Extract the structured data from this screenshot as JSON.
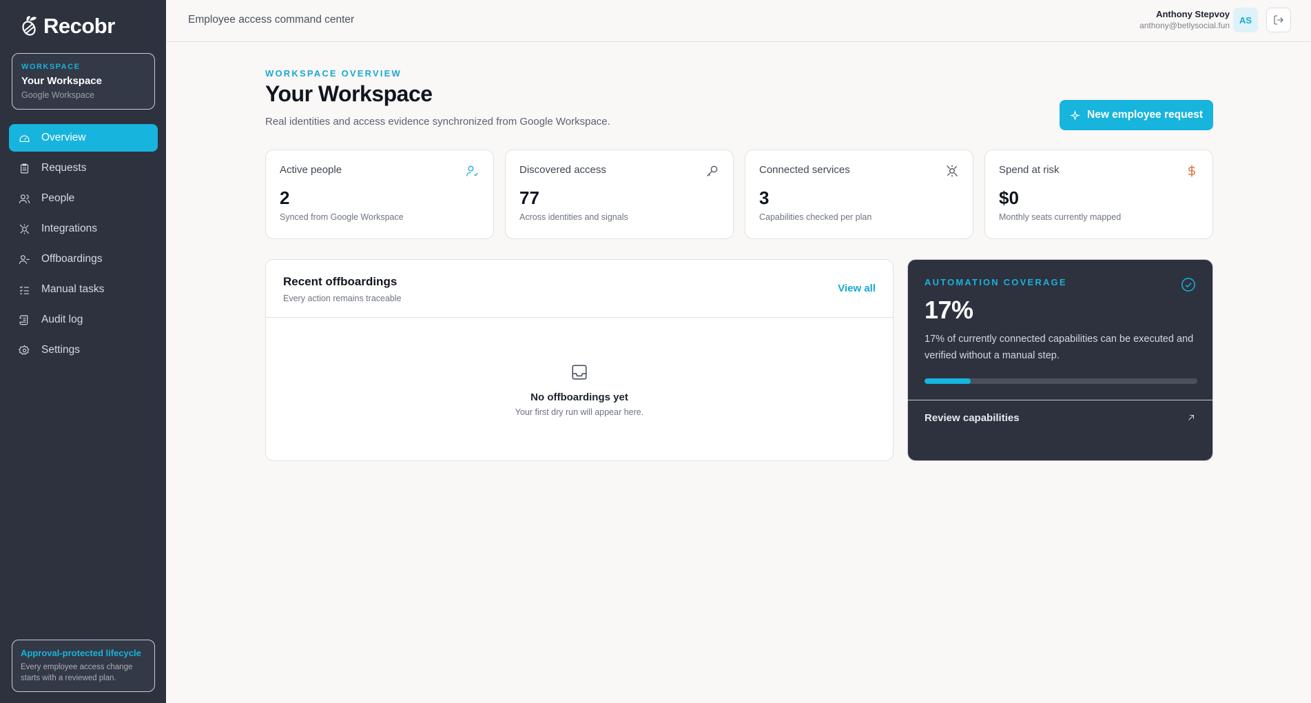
{
  "brand": {
    "name": "Recobr"
  },
  "sidebar": {
    "workspace": {
      "kicker": "WORKSPACE",
      "name": "Your Workspace",
      "provider": "Google Workspace"
    },
    "items": [
      {
        "label": "Overview",
        "icon": "gauge-icon",
        "active": true
      },
      {
        "label": "Requests",
        "icon": "clipboard-icon"
      },
      {
        "label": "People",
        "icon": "users-icon"
      },
      {
        "label": "Integrations",
        "icon": "plug-icon"
      },
      {
        "label": "Offboardings",
        "icon": "user-minus-icon"
      },
      {
        "label": "Manual tasks",
        "icon": "list-checks-icon"
      },
      {
        "label": "Audit log",
        "icon": "scroll-icon"
      },
      {
        "label": "Settings",
        "icon": "gear-icon"
      }
    ],
    "footer": {
      "title": "Approval-protected lifecycle",
      "text": "Every employee access change starts with a reviewed plan."
    }
  },
  "topbar": {
    "title": "Employee access command center",
    "user": {
      "name": "Anthony Stepvoy",
      "email": "anthony@betlysocial.fun",
      "initials": "AS"
    }
  },
  "header": {
    "eyebrow": "WORKSPACE OVERVIEW",
    "title": "Your Workspace",
    "subtitle": "Real identities and access evidence synchronized from Google Workspace.",
    "cta": "New employee request"
  },
  "stats": [
    {
      "label": "Active people",
      "value": "2",
      "hint": "Synced from Google Workspace",
      "icon": "user-check-icon",
      "color": "#17a9d2"
    },
    {
      "label": "Discovered access",
      "value": "77",
      "hint": "Across identities and signals",
      "icon": "key-icon",
      "color": "#4a5160"
    },
    {
      "label": "Connected services",
      "value": "3",
      "hint": "Capabilities checked per plan",
      "icon": "plug-icon",
      "color": "#4a5160"
    },
    {
      "label": "Spend at risk",
      "value": "$0",
      "hint": "Monthly seats currently mapped",
      "icon": "dollar-icon",
      "color": "#d9651f"
    }
  ],
  "recent": {
    "title": "Recent offboardings",
    "subtitle": "Every action remains traceable",
    "view_all": "View all",
    "empty_title": "No offboardings yet",
    "empty_text": "Your first dry run will appear here."
  },
  "automation": {
    "kicker": "AUTOMATION COVERAGE",
    "percent": "17%",
    "progress": 0.17,
    "description": "17% of currently connected capabilities can be executed and verified without a manual step.",
    "link": "Review capabilities"
  },
  "colors": {
    "accent": "#17b4dd",
    "sidebar": "#2d323e",
    "warn": "#d9651f"
  }
}
